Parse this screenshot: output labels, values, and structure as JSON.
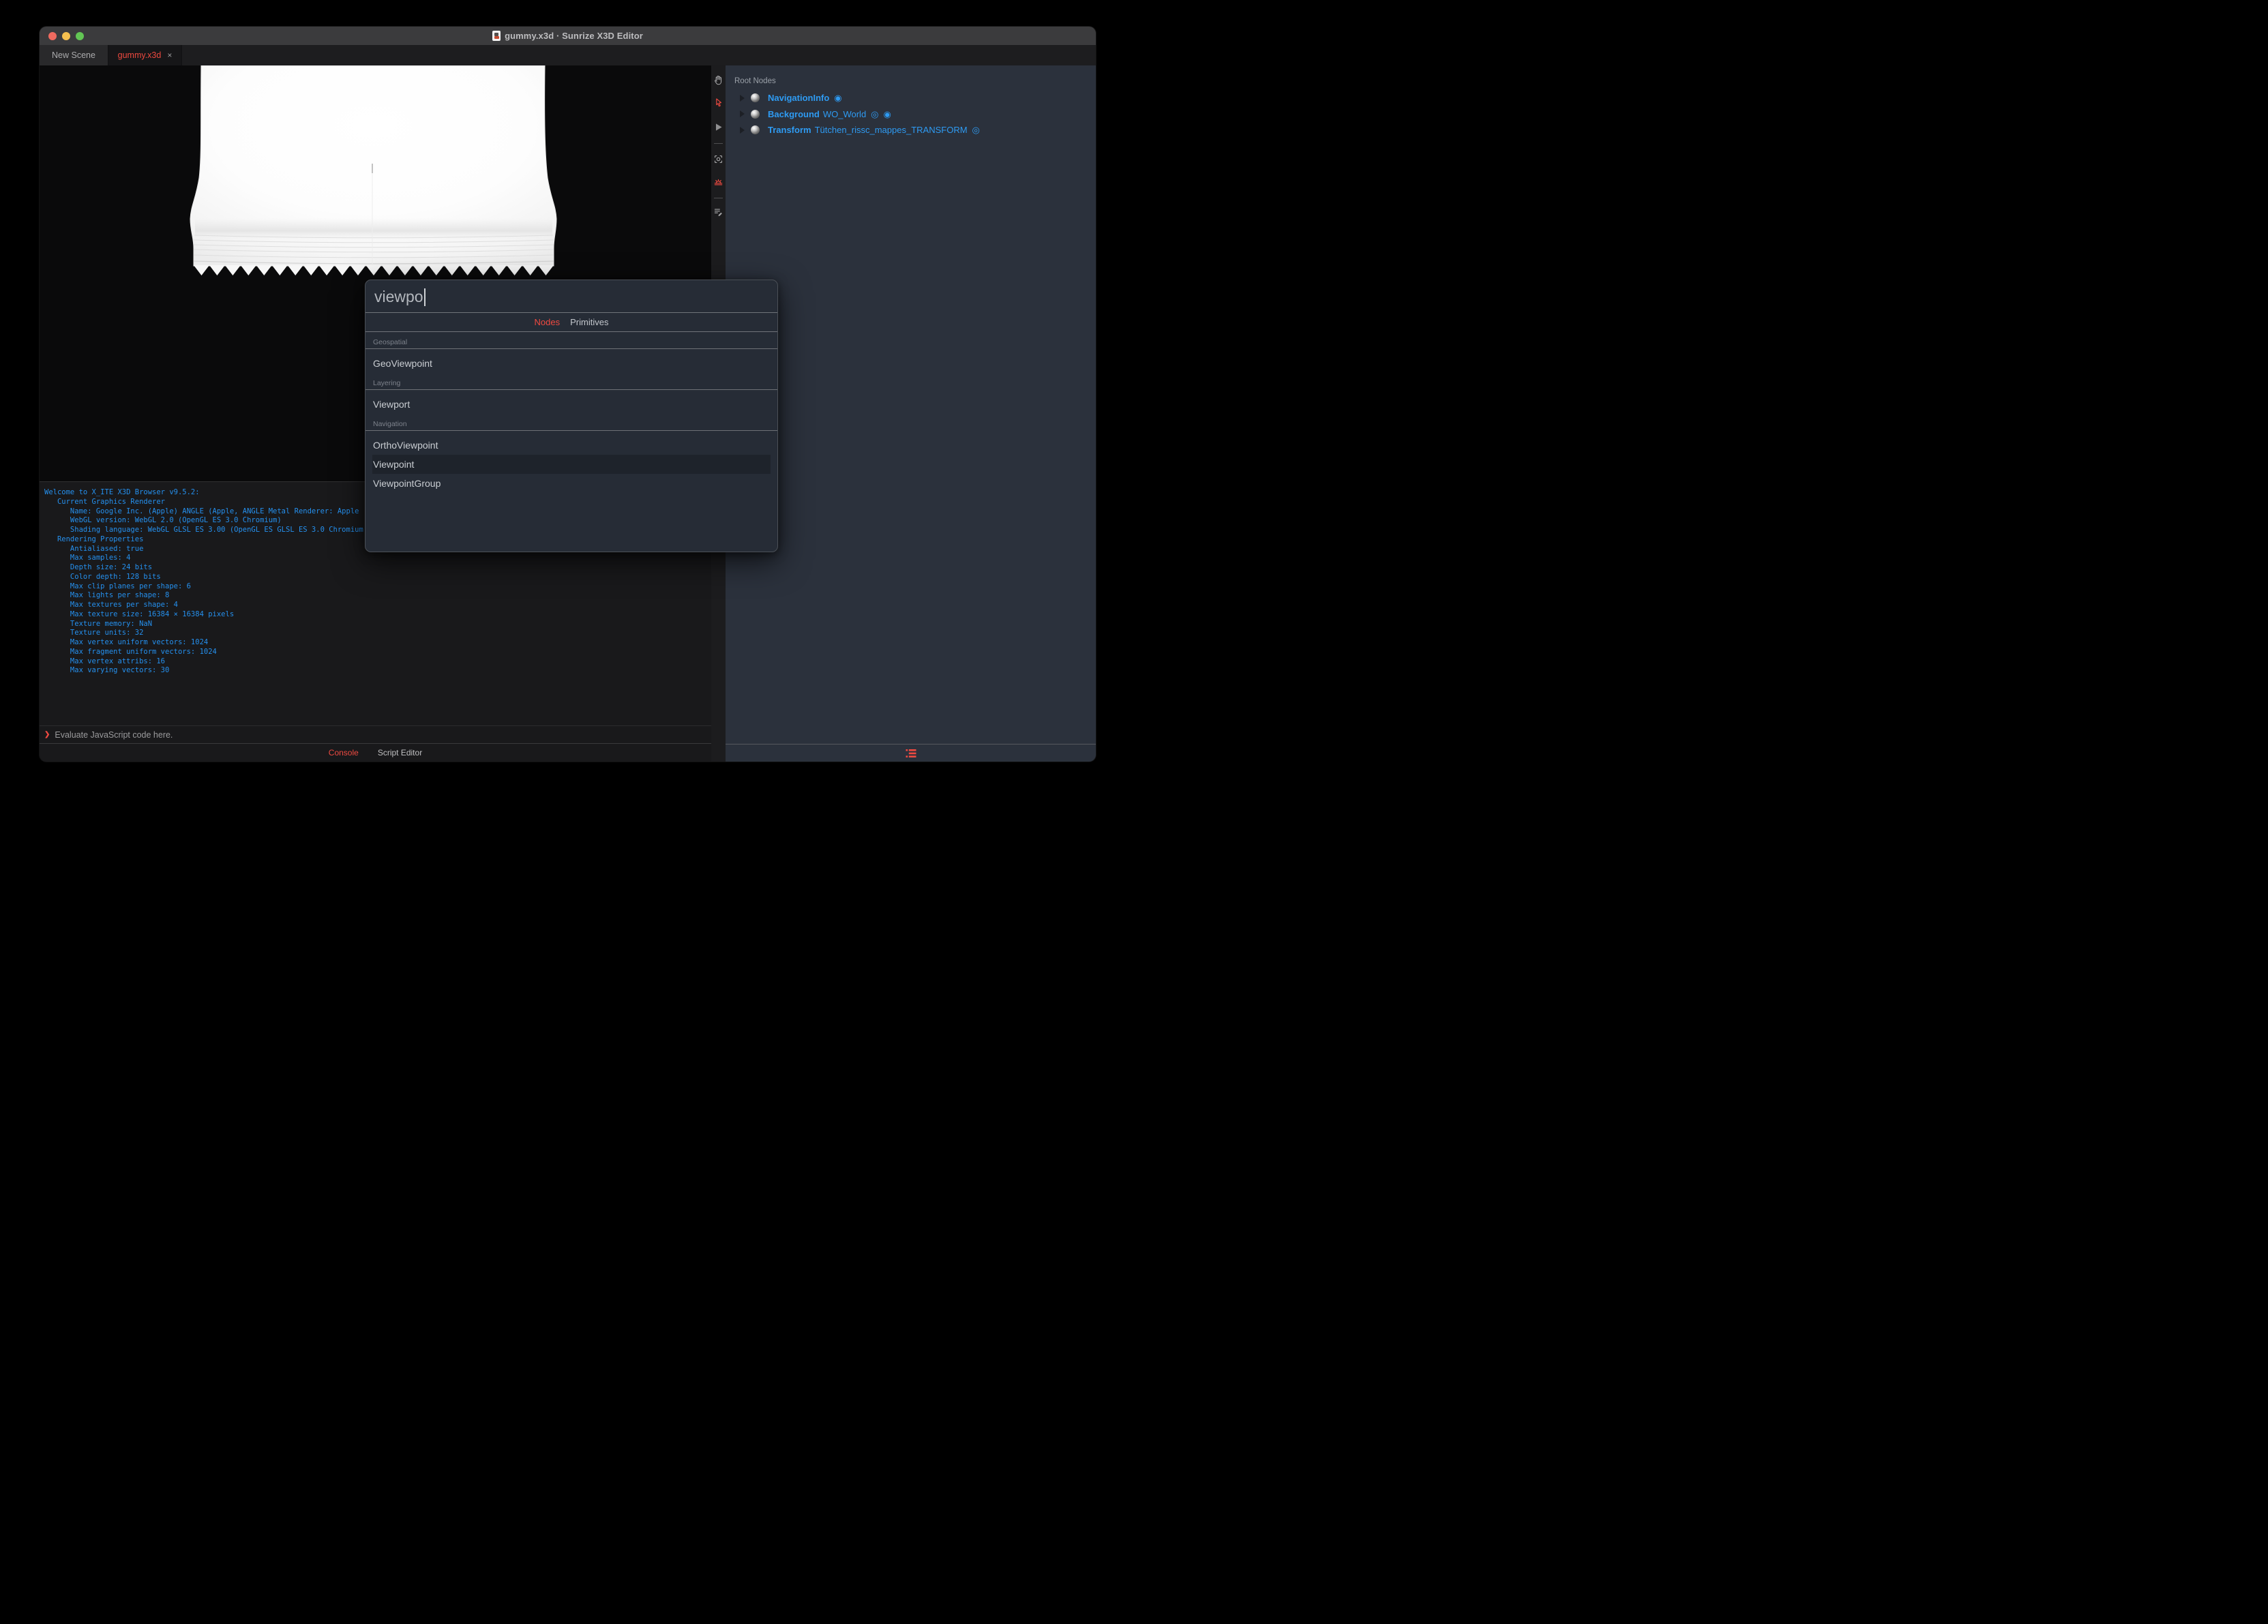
{
  "window": {
    "title": "gummy.x3d · Sunrize X3D Editor"
  },
  "tabs": [
    {
      "label": "New Scene",
      "active": false
    },
    {
      "label": "gummy.x3d",
      "active": true,
      "close": "×"
    }
  ],
  "viewport_toolbar": {
    "icons": [
      {
        "name": "pan-hand-icon",
        "active": false
      },
      {
        "name": "select-arrow-icon",
        "active": true
      },
      {
        "name": "play-icon",
        "active": false
      },
      {
        "name": "frame-camera-icon",
        "active": false
      },
      {
        "name": "sunrise-light-icon",
        "active": true
      },
      {
        "name": "script-edit-icon",
        "active": false
      }
    ]
  },
  "outline": {
    "header": "Root Nodes",
    "badge_glyphs": {
      "fisheye": "◉",
      "bullseye": "◎"
    },
    "nodes": [
      {
        "type": "NavigationInfo",
        "name": "",
        "badges": [
          "fisheye"
        ]
      },
      {
        "type": "Background",
        "name": "WO_World",
        "badges": [
          "bullseye",
          "fisheye"
        ]
      },
      {
        "type": "Transform",
        "name": "Tütchen_rissc_mappes_TRANSFORM",
        "badges": [
          "bullseye"
        ]
      }
    ],
    "bottom_bar": {
      "icon": "list-icon"
    }
  },
  "console": {
    "lines": [
      "Welcome to X_ITE X3D Browser v9.5.2:",
      "   Current Graphics Renderer",
      "      Name: Google Inc. (Apple) ANGLE (Apple, ANGLE Metal Renderer: Apple",
      "      WebGL version: WebGL 2.0 (OpenGL ES 3.0 Chromium)",
      "      Shading language: WebGL GLSL ES 3.00 (OpenGL ES GLSL ES 3.0 Chromium",
      "   Rendering Properties",
      "      Antialiased: true",
      "      Max samples: 4",
      "      Depth size: 24 bits",
      "      Color depth: 128 bits",
      "      Max clip planes per shape: 6",
      "      Max lights per shape: 8",
      "      Max textures per shape: 4",
      "      Max texture size: 16384 × 16384 pixels",
      "      Texture memory: NaN",
      "      Texture units: 32",
      "      Max vertex uniform vectors: 1024",
      "      Max fragment uniform vectors: 1024",
      "      Max vertex attribs: 16",
      "      Max varying vectors: 30"
    ],
    "prompt_symbol": "❯",
    "prompt": "Evaluate JavaScript code here.",
    "tabs": [
      "Console",
      "Script Editor"
    ],
    "active_tab": "Console"
  },
  "dialog": {
    "query": "viewpo",
    "tabs": [
      "Nodes",
      "Primitives"
    ],
    "active_tab": "Nodes",
    "sections": [
      {
        "label": "Geospatial",
        "items": [
          "GeoViewpoint"
        ]
      },
      {
        "label": "Layering",
        "items": [
          "Viewport"
        ]
      },
      {
        "label": "Navigation",
        "items": [
          "OrthoViewpoint",
          "Viewpoint",
          "ViewpointGroup"
        ]
      }
    ],
    "selected_item": "Viewpoint"
  },
  "colors": {
    "accent_red": "#ef4a41",
    "node_blue": "#2e9bf3",
    "console_blue": "#2590ee",
    "panel_slate": "#2b313c",
    "titlebar": "#3b3b3d"
  }
}
